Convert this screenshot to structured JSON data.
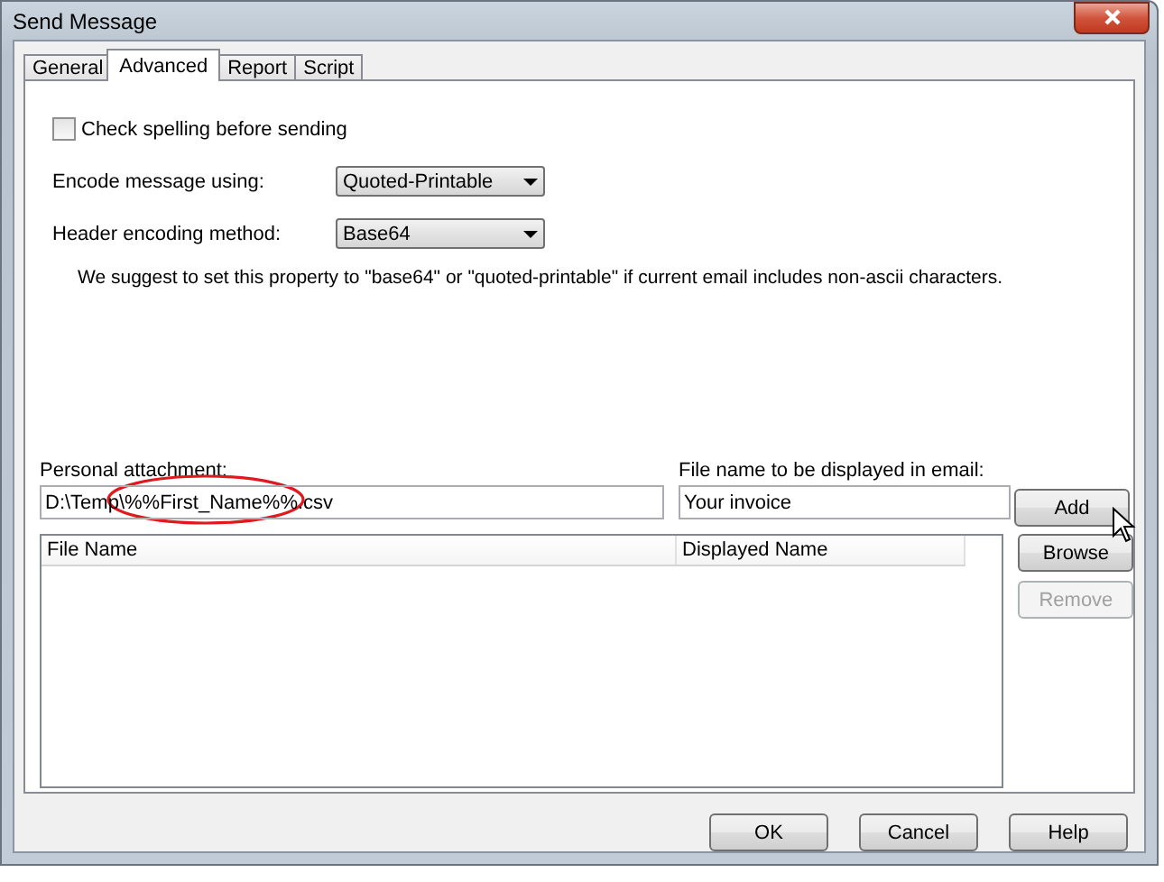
{
  "window": {
    "title": "Send Message"
  },
  "tabs": [
    {
      "label": "General",
      "selected": false
    },
    {
      "label": "Advanced",
      "selected": true
    },
    {
      "label": "Report",
      "selected": false
    },
    {
      "label": "Script",
      "selected": false
    }
  ],
  "spell_check": {
    "label": "Check spelling before sending",
    "checked": false
  },
  "encode_message": {
    "label": "Encode message using:",
    "value": "Quoted-Printable"
  },
  "header_encoding": {
    "label": "Header encoding method:",
    "value": "Base64"
  },
  "hint": "We suggest to set this property to \"base64\" or \"quoted-printable\"  if current email includes non-ascii characters.",
  "personal_attachment": {
    "label": "Personal attachment:",
    "value": "D:\\Temp\\%%First_Name%%.csv"
  },
  "display_name": {
    "label": "File name to be displayed in email:",
    "value": "Your invoice"
  },
  "attachment_buttons": [
    {
      "label": "Add",
      "disabled": false
    },
    {
      "label": "Browse",
      "disabled": false
    },
    {
      "label": "Remove",
      "disabled": true
    }
  ],
  "attachments_table": {
    "columns": [
      "File Name",
      "Displayed Name"
    ]
  },
  "buttons": [
    {
      "label": "OK"
    },
    {
      "label": "Cancel"
    },
    {
      "label": "Help"
    }
  ]
}
